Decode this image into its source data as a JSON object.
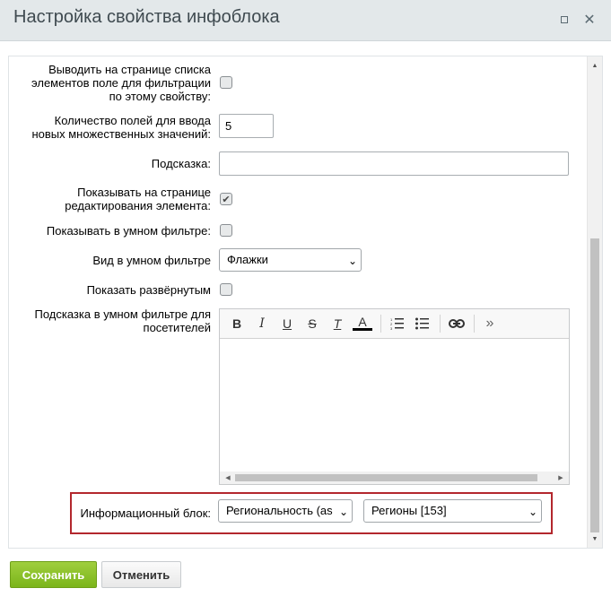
{
  "dialog": {
    "title": "Настройка свойства инфоблока",
    "maximize_icon": "maximize-icon",
    "close_icon": "close-icon",
    "close_glyph": "✕"
  },
  "form": {
    "filter_field": {
      "label_lines": [
        "Выводить на странице списка",
        "элементов поле для фильтрации",
        "по этому свойству:"
      ],
      "checked": false
    },
    "multiple_count": {
      "label_lines": [
        "Количество полей для ввода",
        "новых множественных значений:"
      ],
      "value": "5"
    },
    "hint": {
      "label": "Подсказка:",
      "value": ""
    },
    "show_on_edit": {
      "label_lines": [
        "Показывать на странице",
        "редактирования элемента:"
      ],
      "checked": true,
      "check_glyph": "✔"
    },
    "show_smart_filter": {
      "label": "Показывать в умном фильтре:",
      "checked": false
    },
    "smart_filter_view": {
      "label": "Вид в умном фильтре",
      "selected": "Флажки"
    },
    "show_expanded": {
      "label": "Показать развёрнутым",
      "checked": false
    },
    "smart_filter_hint": {
      "label_lines": [
        "Подсказка в умном фильтре для",
        "посетителей"
      ]
    },
    "iblock": {
      "label": "Информационный блок:",
      "type_selected": "Региональность (as",
      "block_selected": "Регионы [153]"
    }
  },
  "editor": {
    "toolbar": [
      {
        "name": "bold-icon",
        "glyph": "B"
      },
      {
        "name": "italic-icon",
        "glyph": "I"
      },
      {
        "name": "underline-icon",
        "glyph": "U"
      },
      {
        "name": "strikethrough-icon",
        "glyph": "S"
      },
      {
        "name": "clear-format-icon",
        "glyph": "T"
      },
      {
        "name": "font-color-icon",
        "glyph": "A"
      },
      {
        "name": "ordered-list-icon",
        "glyph": ""
      },
      {
        "name": "unordered-list-icon",
        "glyph": ""
      },
      {
        "name": "link-icon",
        "glyph": ""
      },
      {
        "name": "more-icon",
        "glyph": "»"
      }
    ],
    "font_color": "#000000"
  },
  "footer": {
    "save_label": "Сохранить",
    "cancel_label": "Отменить"
  },
  "colors": {
    "save_button": "#8cc22a",
    "highlight_border": "#b3272d",
    "titlebar_bg": "#e3e8ea"
  }
}
